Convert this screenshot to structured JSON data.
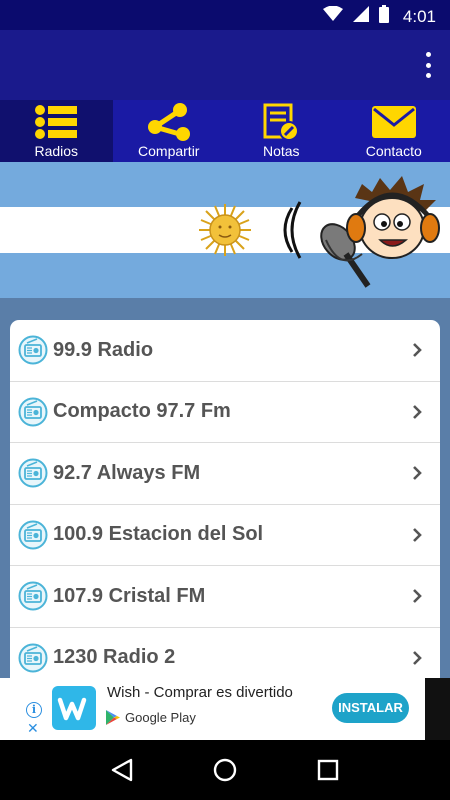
{
  "status_bar": {
    "time": "4:01",
    "icons": [
      "wifi-icon",
      "cellular-signal-icon",
      "battery-icon"
    ]
  },
  "app_bar": {
    "overflow_icon": "more-vert-icon"
  },
  "tabs": [
    {
      "label": "Radios",
      "icon": "list-icon",
      "active": true
    },
    {
      "label": "Compartir",
      "icon": "share-icon",
      "active": false
    },
    {
      "label": "Notas",
      "icon": "notes-edit-icon",
      "active": false
    },
    {
      "label": "Contacto",
      "icon": "mail-icon",
      "active": false
    }
  ],
  "banner": {
    "description_icons": [
      "sun-of-may-icon",
      "microphone-icon",
      "cartoon-headphones-icon"
    ]
  },
  "stations": [
    {
      "name": "99.9 Radio"
    },
    {
      "name": "Compacto 97.7 Fm"
    },
    {
      "name": "92.7 Always FM"
    },
    {
      "name": "100.9 Estacion del Sol"
    },
    {
      "name": "107.9 Cristal FM"
    },
    {
      "name": "1230 Radio 2"
    }
  ],
  "ad": {
    "app_name": "Wish - Comprar es divertido",
    "store_label": "Google Play",
    "install_label": "INSTALAR",
    "info_glyph": "i",
    "close_glyph": "✕"
  },
  "colors": {
    "primary_dark": "#0b0b6e",
    "primary": "#1a1a8c",
    "tab_active": "#10106e",
    "accent_yellow": "#ffd600",
    "flag_blue": "#74aadd",
    "install_button": "#1ea3c9"
  }
}
